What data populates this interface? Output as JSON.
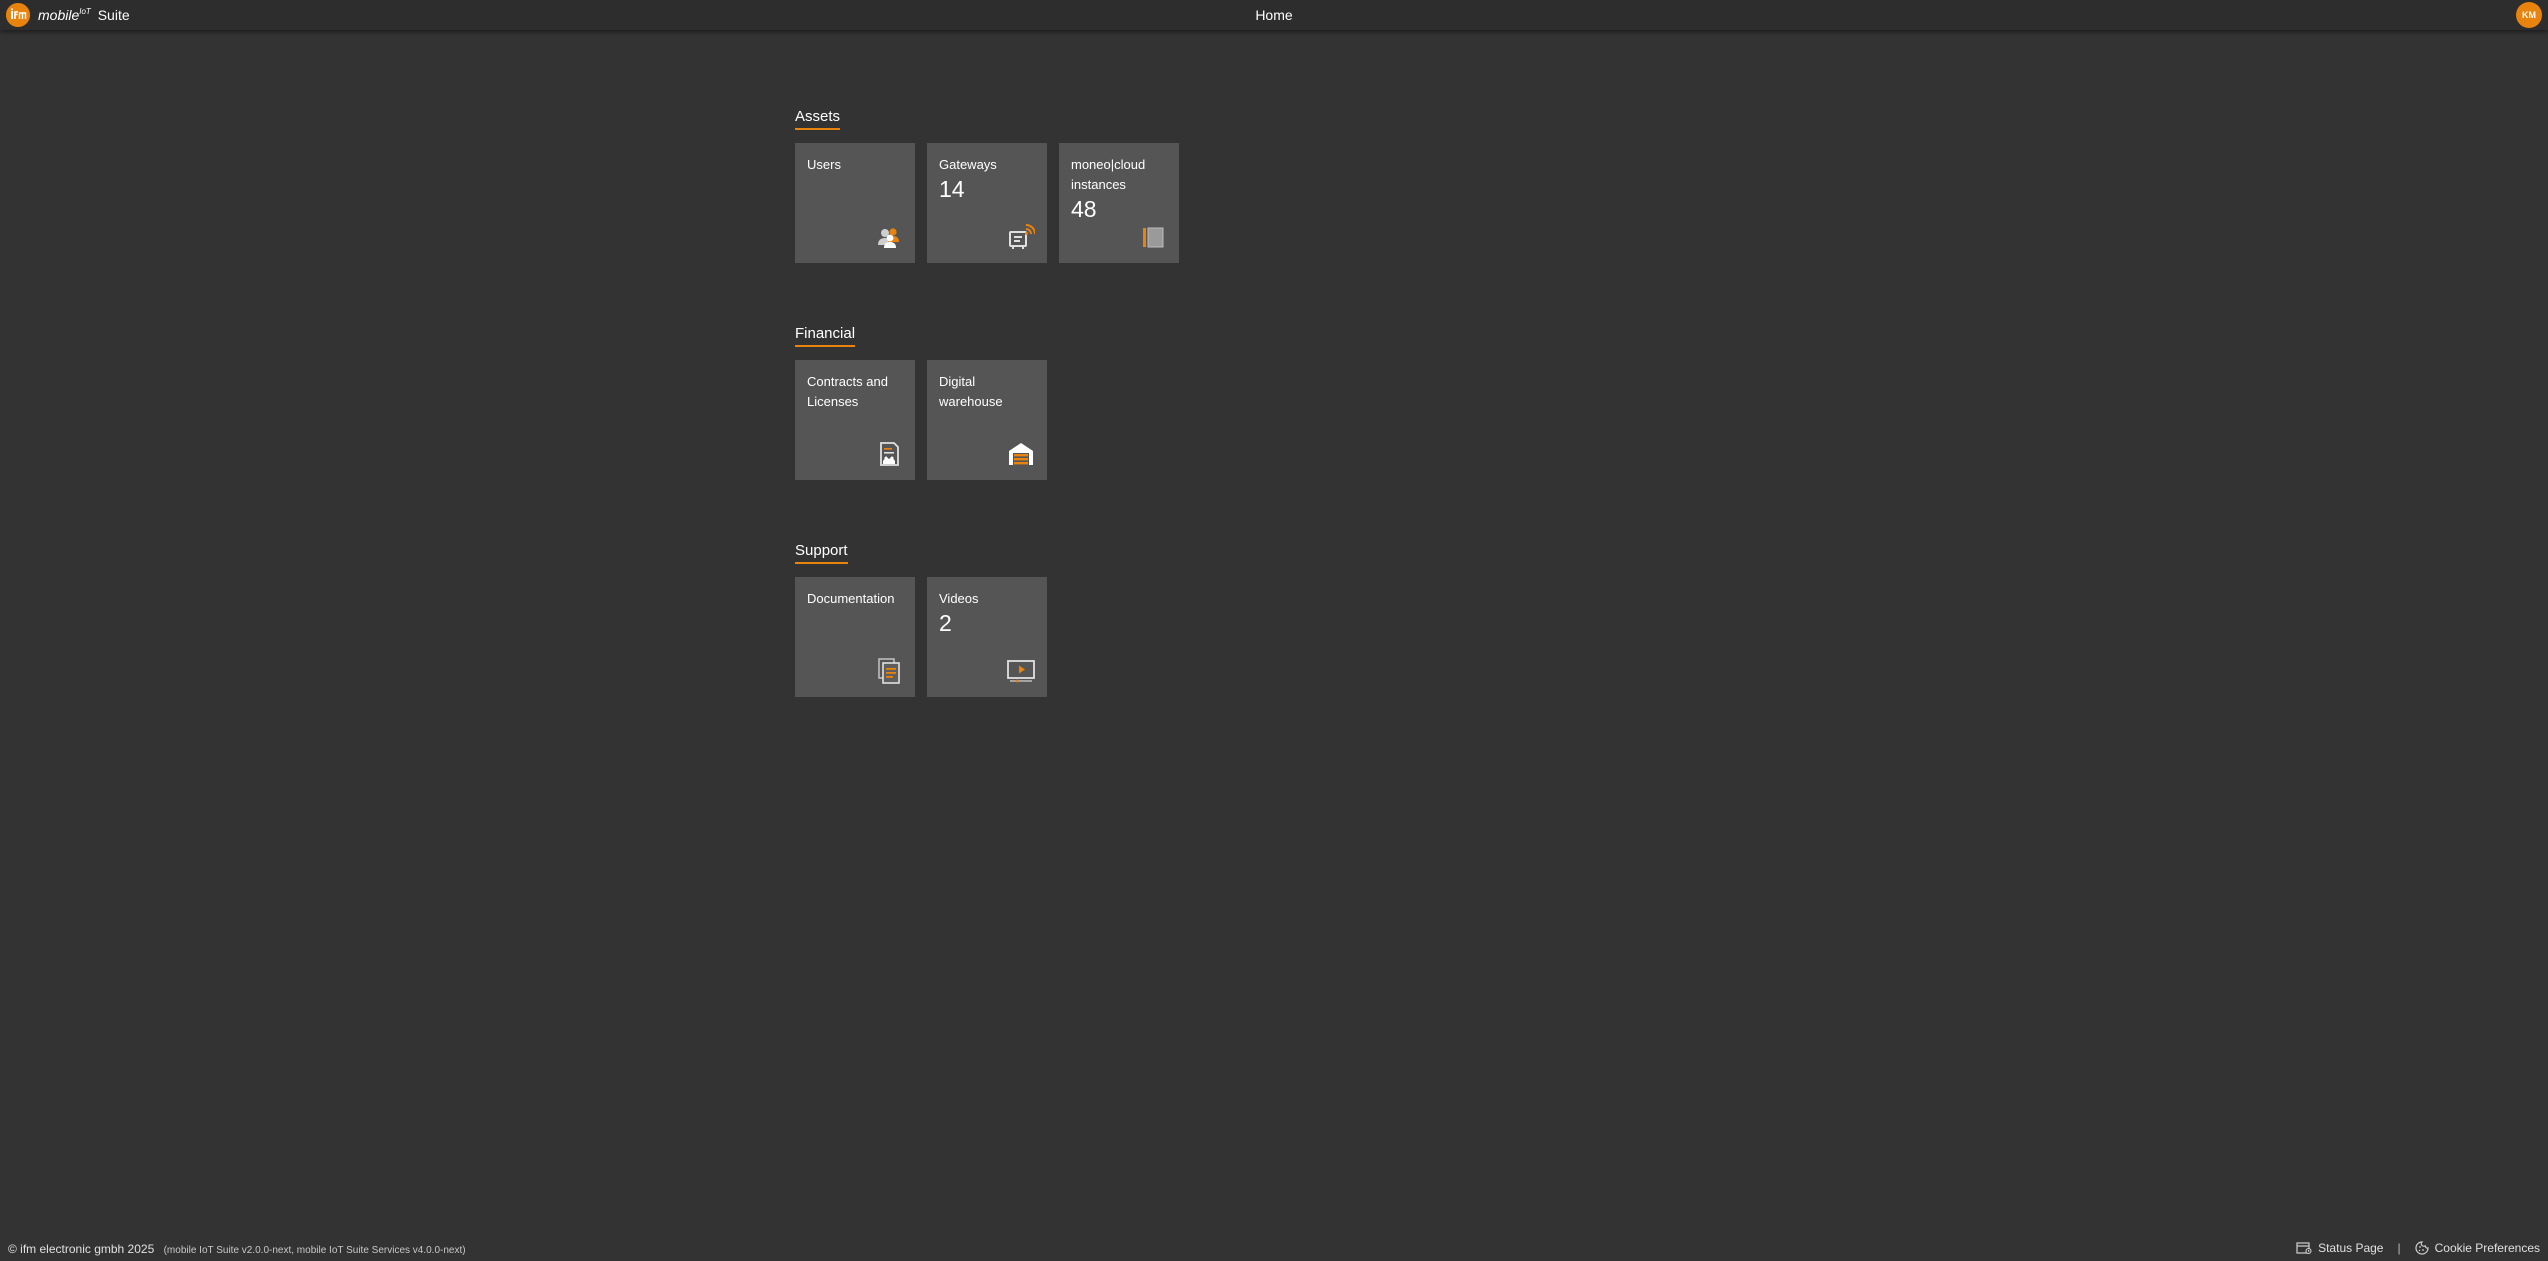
{
  "header": {
    "brand_mobile": "mobile",
    "brand_sup": "IoT",
    "brand_suite": "Suite",
    "page_title": "Home",
    "user_initials": "KM"
  },
  "sections": {
    "assets": {
      "title": "Assets",
      "tiles": [
        {
          "label": "Users",
          "count": "",
          "icon": "users-icon"
        },
        {
          "label": "Gateways",
          "count": "14",
          "icon": "gateway-icon"
        },
        {
          "label": "moneo|cloud instances",
          "count": "48",
          "icon": "cloud-instance-icon"
        }
      ]
    },
    "financial": {
      "title": "Financial",
      "tiles": [
        {
          "label": "Contracts and Licenses",
          "count": "",
          "icon": "contract-icon"
        },
        {
          "label": "Digital warehouse",
          "count": "",
          "icon": "warehouse-icon"
        }
      ]
    },
    "support": {
      "title": "Support",
      "tiles": [
        {
          "label": "Documentation",
          "count": "",
          "icon": "documentation-icon"
        },
        {
          "label": "Videos",
          "count": "2",
          "icon": "video-icon"
        }
      ]
    }
  },
  "footer": {
    "copyright": "© ifm electronic gmbh 2025",
    "version": "(mobile IoT Suite v2.0.0-next, mobile IoT Suite Services v4.0.0-next)",
    "status_page": "Status Page",
    "separator": "|",
    "cookie_preferences": "Cookie Preferences"
  },
  "colors": {
    "background": "#333333",
    "header": "#2d2d2d",
    "tile": "#555555",
    "accent": "#e8830e"
  }
}
